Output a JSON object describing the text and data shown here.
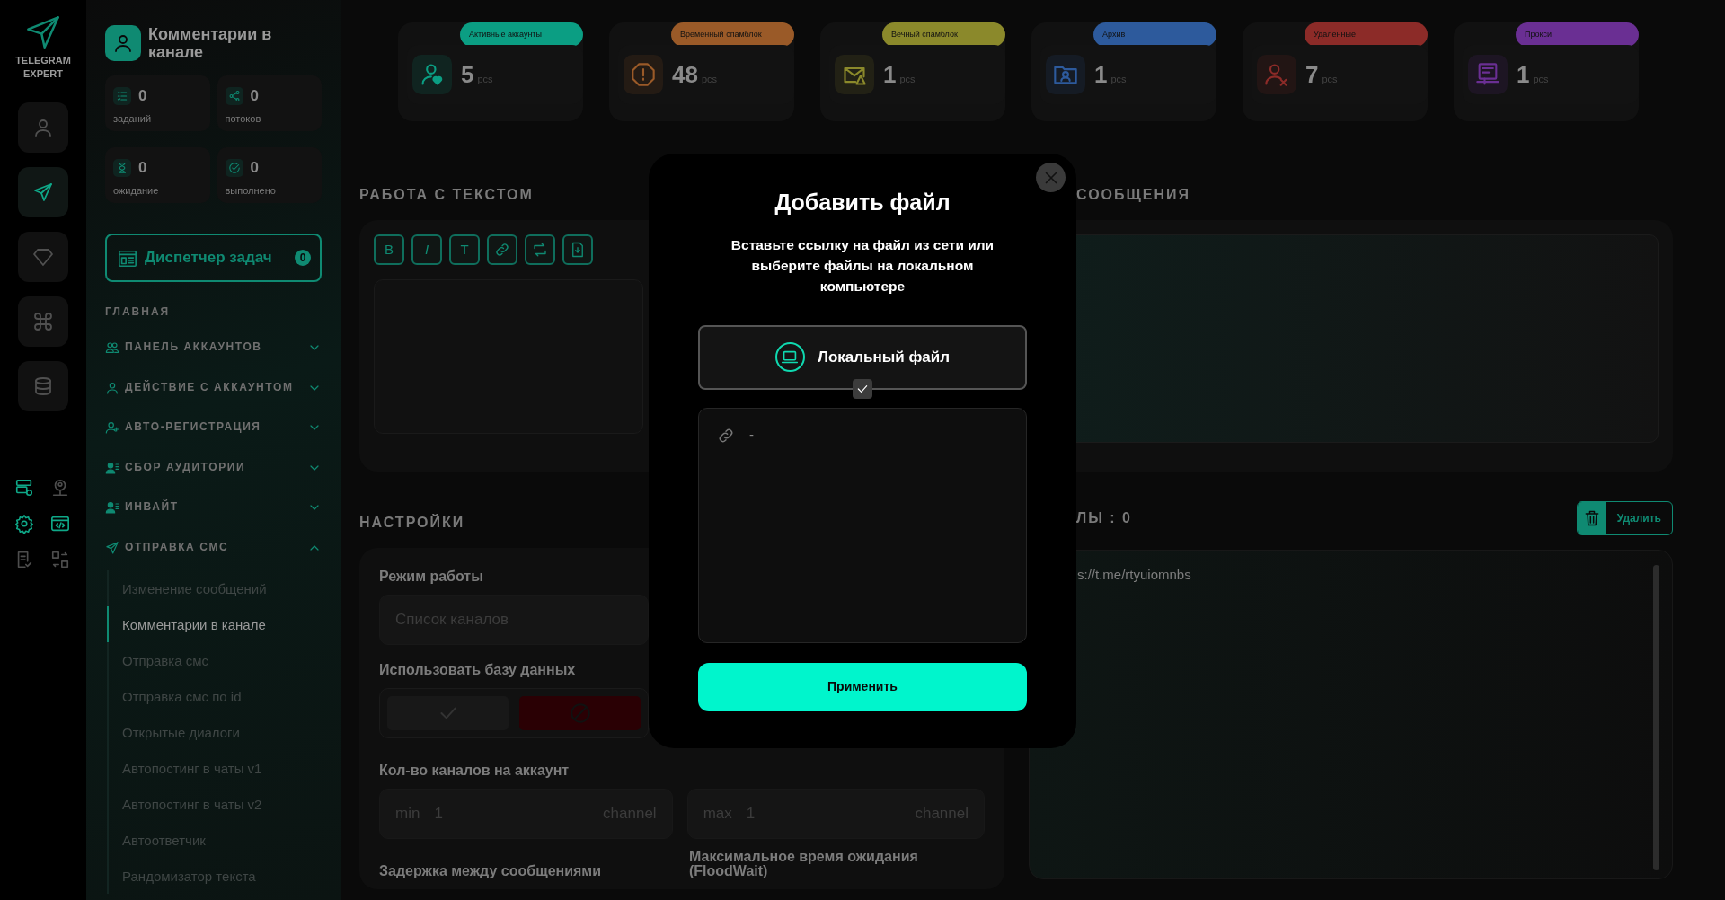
{
  "logo": {
    "lines": [
      "TELEGRAM",
      "EXPERT"
    ]
  },
  "rail": [
    {
      "kind": "user",
      "selected": false
    },
    {
      "kind": "send",
      "selected": true
    },
    {
      "kind": "diamond",
      "selected": false
    },
    {
      "kind": "command",
      "selected": false
    },
    {
      "kind": "database",
      "selected": false
    }
  ],
  "rail_tools": [
    {
      "kind": "server-check",
      "highlighted": true
    },
    {
      "kind": "user-pin",
      "highlighted": false
    },
    {
      "kind": "gear",
      "highlighted": true
    },
    {
      "kind": "code",
      "highlighted": true
    },
    {
      "kind": "doc-check",
      "highlighted": false
    },
    {
      "kind": "swap",
      "highlighted": false
    }
  ],
  "sidebar": {
    "title": "Комментарии в канале",
    "stats": [
      {
        "kind": "tasks",
        "value": "0",
        "label": "заданий"
      },
      {
        "kind": "share",
        "value": "0",
        "label": "потоков"
      },
      {
        "kind": "hourglass",
        "value": "0",
        "label": "ожидание"
      },
      {
        "kind": "check-circle",
        "value": "0",
        "label": "выполнено"
      }
    ],
    "dispatcher": {
      "label": "Диспетчер задач",
      "count": "0"
    },
    "section_title": "ГЛАВНАЯ",
    "menu": [
      {
        "kind": "users",
        "label": "ПАНЕЛЬ АККАУНТОВ",
        "expanded": false
      },
      {
        "kind": "user",
        "label": "ДЕЙСТВИЕ С АККАУНТОМ",
        "expanded": false
      },
      {
        "kind": "user-plus",
        "label": "АВТО-РЕГИСТРАЦИЯ",
        "expanded": false
      },
      {
        "kind": "user-list",
        "label": "СБОР АУДИТОРИИ",
        "expanded": false
      },
      {
        "kind": "user-list",
        "label": "ИНВАЙТ",
        "expanded": false
      },
      {
        "kind": "send",
        "label": "ОТПРАВКА СМС",
        "expanded": true,
        "children": [
          {
            "label": "Изменение сообщений",
            "selected": false
          },
          {
            "label": "Комментарии в канале",
            "selected": true
          },
          {
            "label": "Отправка смс",
            "selected": false
          },
          {
            "label": "Отправка смс по id",
            "selected": false
          },
          {
            "label": "Открытые диалоги",
            "selected": false
          },
          {
            "label": "Автопостинг в чаты v1",
            "selected": false
          },
          {
            "label": "Автопостинг в чаты v2",
            "selected": false
          },
          {
            "label": "Автоответчик",
            "selected": false
          },
          {
            "label": "Рандомизатор текста",
            "selected": false
          }
        ]
      }
    ]
  },
  "counters": [
    {
      "kind": "user-heart",
      "label": "Активные аккаунты",
      "color": "#0b9e83",
      "value": "5",
      "unit": "pcs"
    },
    {
      "kind": "alert",
      "label": "Временный спамблок",
      "color": "#9a5a28",
      "value": "48",
      "unit": "pcs"
    },
    {
      "kind": "mail-warning",
      "label": "Вечный спамблок",
      "color": "#8b892b",
      "value": "1",
      "unit": "pcs"
    },
    {
      "kind": "folder-user",
      "label": "Архив",
      "color": "#2d5a9c",
      "value": "1",
      "unit": "pcs"
    },
    {
      "kind": "user-x",
      "label": "Удаленные",
      "color": "#8c2b28",
      "value": "7",
      "unit": "pcs"
    },
    {
      "kind": "proxy",
      "label": "Прокси",
      "color": "#6a2f93",
      "value": "1",
      "unit": "pcs"
    }
  ],
  "text_work": {
    "title": "РАБОТА С ТЕКСТОМ",
    "tools": [
      {
        "kind": "letter",
        "label": "B"
      },
      {
        "kind": "letter-italic",
        "label": "I"
      },
      {
        "kind": "letter",
        "label": "T"
      },
      {
        "kind": "link"
      },
      {
        "kind": "repeat"
      },
      {
        "kind": "file-down"
      }
    ]
  },
  "settings": {
    "title": "НАСТРОЙКИ",
    "mode": {
      "label": "Режим работы",
      "placeholder": "Список каналов"
    },
    "use_db": {
      "label": "Использовать базу данных",
      "on": false
    },
    "channels": {
      "label": "Кол-во каналов на аккаунт",
      "fields": [
        {
          "prefix": "min",
          "placeholder": "1",
          "unit": "channel"
        },
        {
          "prefix": "max",
          "placeholder": "1",
          "unit": "channel"
        }
      ]
    },
    "delay_label": "Задержка между сообщениями",
    "floodwait_label": "Максимальное время ожидания (FloodWait)"
  },
  "messages": {
    "title": "СООБЩЕНИЯ"
  },
  "links": {
    "title": "ЛЫ : 0",
    "delete_label": "Удалить",
    "text": "s://t.me/rtyuiomnbs"
  },
  "modal": {
    "title": "Добавить файл",
    "description": "Вставьте ссылку на файл из сети или выберите файлы на локальном компьютере",
    "local_file": {
      "label": "Локальный файл",
      "checked": true
    },
    "link_value": "-",
    "apply_label": "Применить"
  }
}
